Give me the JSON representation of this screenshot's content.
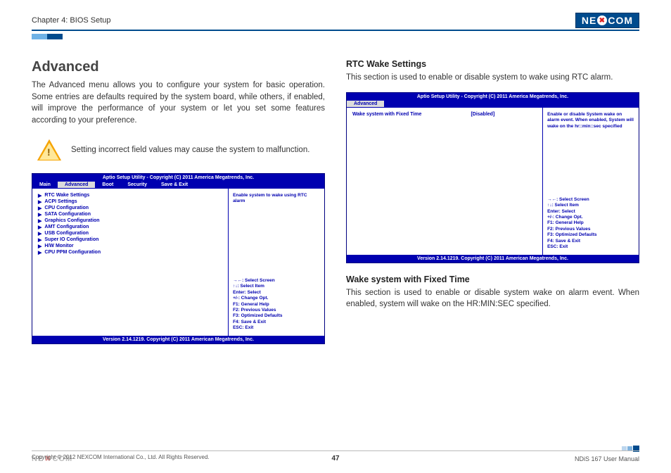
{
  "header": {
    "chapter": "Chapter 4: BIOS Setup",
    "logo_pre": "NE",
    "logo_x": "✖",
    "logo_post": "COM"
  },
  "left": {
    "h1": "Advanced",
    "intro": "The Advanced menu allows you to configure your system for basic operation. Some entries are defaults required by the system board, while others, if enabled, will improve the performance of your system or let you set some features according to your preference.",
    "warn": "Setting incorrect field values may cause the system to malfunction.",
    "bios": {
      "title": "Aptio Setup Utility - Copyright (C) 2011 America Megatrends, Inc.",
      "tabs": [
        "Main",
        "Advanced",
        "Boot",
        "Security",
        "Save & Exit"
      ],
      "items": [
        "RTC Wake Settings",
        "ACPI Settings",
        "CPU Configuration",
        "SATA Configuration",
        "Graphics Configuration",
        "AMT Configuration",
        "USB Configuration",
        "Super IO Configuration",
        "H/W Monitor",
        "CPU PPM Configuration"
      ],
      "sidetop": "Enable system to wake using RTC alarm",
      "help": [
        "→←: Select Screen",
        "↑↓: Select Item",
        "Enter: Select",
        "+/-: Change Opt.",
        "F1: General Help",
        "F2: Previous Values",
        "F3: Optimized Defaults",
        "F4: Save & Exit",
        "ESC: Exit"
      ],
      "version": "Version 2.14.1219. Copyright (C) 2011 American Megatrends, Inc."
    }
  },
  "right": {
    "h3a": "RTC Wake Settings",
    "pa": "This section is used to enable or disable system to wake using RTC alarm.",
    "bios": {
      "title": "Aptio Setup Utility - Copyright (C) 2011 America Megatrends, Inc.",
      "tab": "Advanced",
      "opt_label": "Wake system with Fixed Time",
      "opt_value": "[Disabled]",
      "sidetop": "Enable or disable System wake on alarm event. When enabled, System will wake on the hr::min::sec specified",
      "help": [
        "→←: Select Screen",
        "↑↓: Select Item",
        "Enter: Select",
        "+/-: Change Opt.",
        "F1: General Help",
        "F2: Previous Values",
        "F3: Optimized Defaults",
        "F4: Save & Exit",
        "ESC: Exit"
      ],
      "version": "Version 2.14.1219. Copyright (C) 2011 American Megatrends, Inc."
    },
    "h3b": "Wake system with Fixed Time",
    "pb": "This section is used to enable or disable system wake on alarm event. When enabled, system will wake on the HR:MIN:SEC specified."
  },
  "footer": {
    "copyright": "Copyright © 2012 NEXCOM International Co., Ltd. All Rights Reserved.",
    "page": "47",
    "doc": "NDiS 167 User Manual"
  }
}
